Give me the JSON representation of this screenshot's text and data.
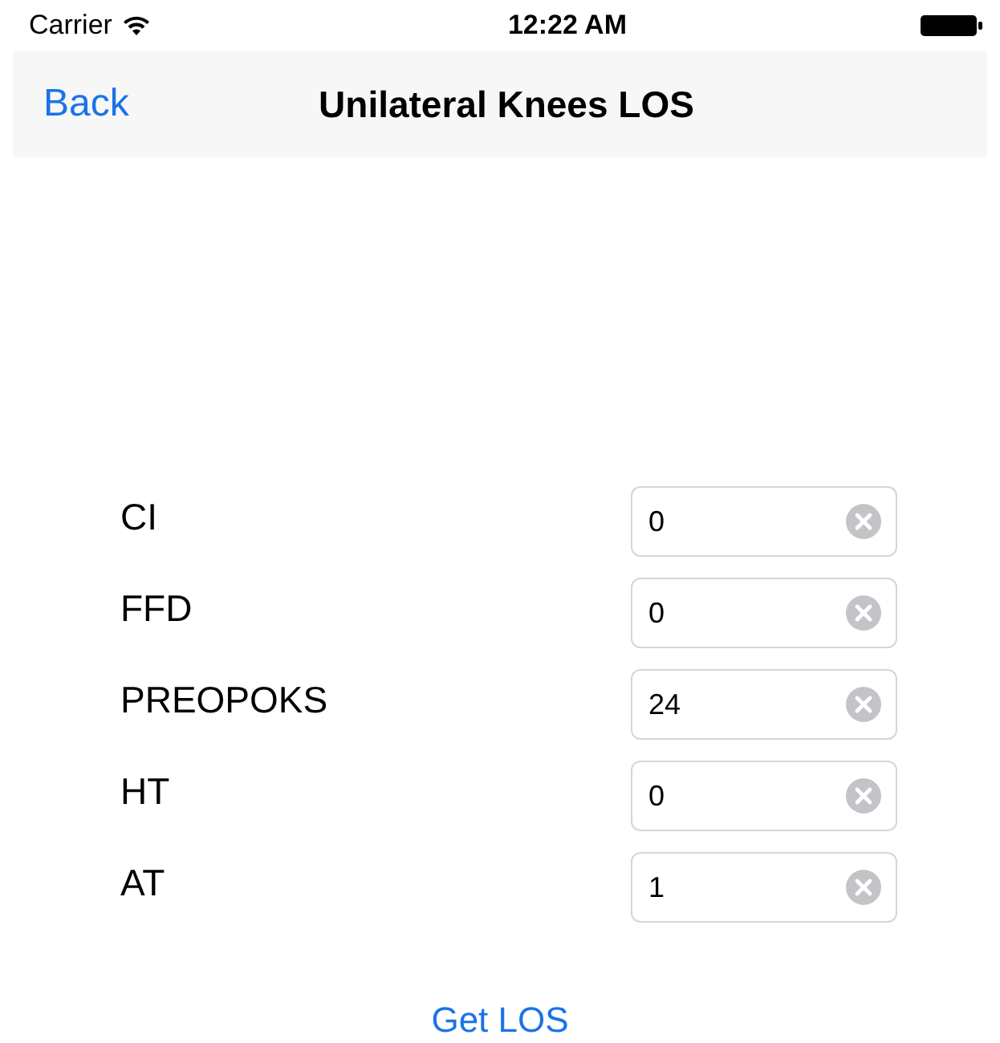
{
  "status_bar": {
    "carrier": "Carrier",
    "time": "12:22 AM"
  },
  "nav_bar": {
    "back": "Back",
    "title": "Unilateral Knees LOS"
  },
  "fields": [
    {
      "label": "CI",
      "value": "0"
    },
    {
      "label": "FFD",
      "value": "0"
    },
    {
      "label": "PREOPOKS",
      "value": "24"
    },
    {
      "label": "HT",
      "value": "0"
    },
    {
      "label": "AT",
      "value": "1"
    }
  ],
  "button": "Get LOS"
}
